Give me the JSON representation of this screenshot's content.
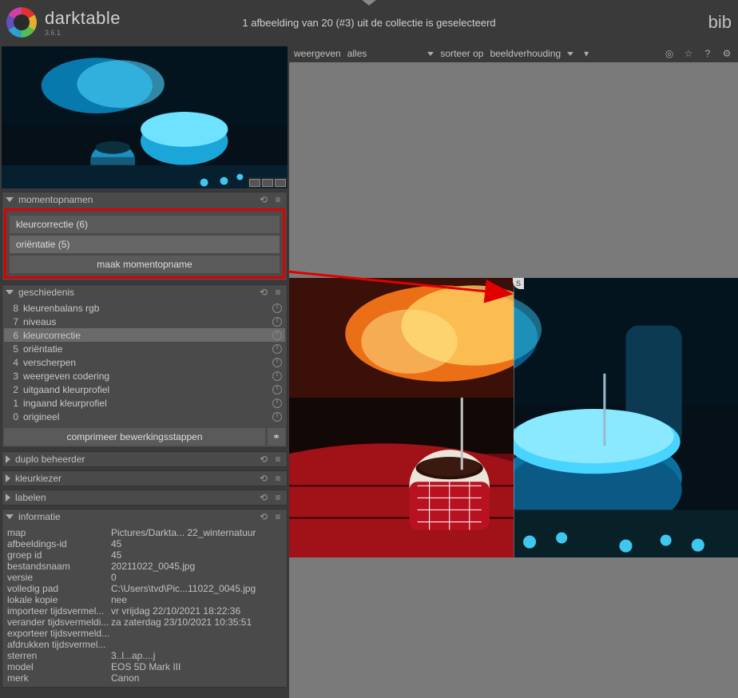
{
  "app": {
    "name": "darktable",
    "version": "3.6.1",
    "right_label": "bib"
  },
  "status": "1 afbeelding van 20 (#3) uit de collectie is geselecteerd",
  "filter": {
    "show_label": "weergeven",
    "show_value": "alles",
    "sort_label": "sorteer op",
    "sort_value": "beeldverhouding"
  },
  "panels": {
    "snapshots": {
      "title": "momentopnamen",
      "items": [
        "kleurcorrectie (6)",
        "oriëntatie (5)"
      ],
      "button": "maak momentopname"
    },
    "history": {
      "title": "geschiedenis",
      "compress": "comprimeer bewerkingsstappen",
      "items": [
        {
          "n": "8",
          "label": "kleurenbalans rgb",
          "sel": false
        },
        {
          "n": "7",
          "label": "niveaus",
          "sel": false
        },
        {
          "n": "6",
          "label": "kleurcorrectie",
          "sel": true
        },
        {
          "n": "5",
          "label": "oriëntatie",
          "sel": false
        },
        {
          "n": "4",
          "label": "verscherpen",
          "sel": false
        },
        {
          "n": "3",
          "label": "weergeven codering",
          "sel": false
        },
        {
          "n": "2",
          "label": "uitgaand kleurprofiel",
          "sel": false
        },
        {
          "n": "1",
          "label": "ingaand kleurprofiel",
          "sel": false
        },
        {
          "n": "0",
          "label": "origineel",
          "sel": false
        }
      ]
    },
    "duplicate": {
      "title": "duplo beheerder"
    },
    "colorpicker": {
      "title": "kleurkiezer"
    },
    "tags": {
      "title": "labelen"
    },
    "info": {
      "title": "informatie",
      "rows": [
        {
          "k": "map",
          "v": "Pictures/Darkta...  22_winternatuur"
        },
        {
          "k": "afbeeldings-id",
          "v": "45"
        },
        {
          "k": "groep id",
          "v": "45"
        },
        {
          "k": "bestandsnaam",
          "v": "20211022_0045.jpg"
        },
        {
          "k": "versie",
          "v": "0"
        },
        {
          "k": "volledig pad",
          "v": "C:\\Users\\tvd\\Pic...11022_0045.jpg"
        },
        {
          "k": "lokale kopie",
          "v": "nee"
        },
        {
          "k": "importeer tijdsvermel...",
          "v": "vr vrijdag 22/10/2021 18:22:36"
        },
        {
          "k": "verander tijdsvermeldi...",
          "v": "za zaterdag 23/10/2021 10:35:51"
        },
        {
          "k": "exporteer tijdsvermeld...",
          "v": ""
        },
        {
          "k": "afdrukken tijdsvermel...",
          "v": ""
        },
        {
          "k": "sterren",
          "v": "3..l...ap....j"
        },
        {
          "k": "model",
          "v": "EOS 5D Mark III"
        },
        {
          "k": "merk",
          "v": "Canon"
        }
      ]
    }
  },
  "split_badge": "S"
}
